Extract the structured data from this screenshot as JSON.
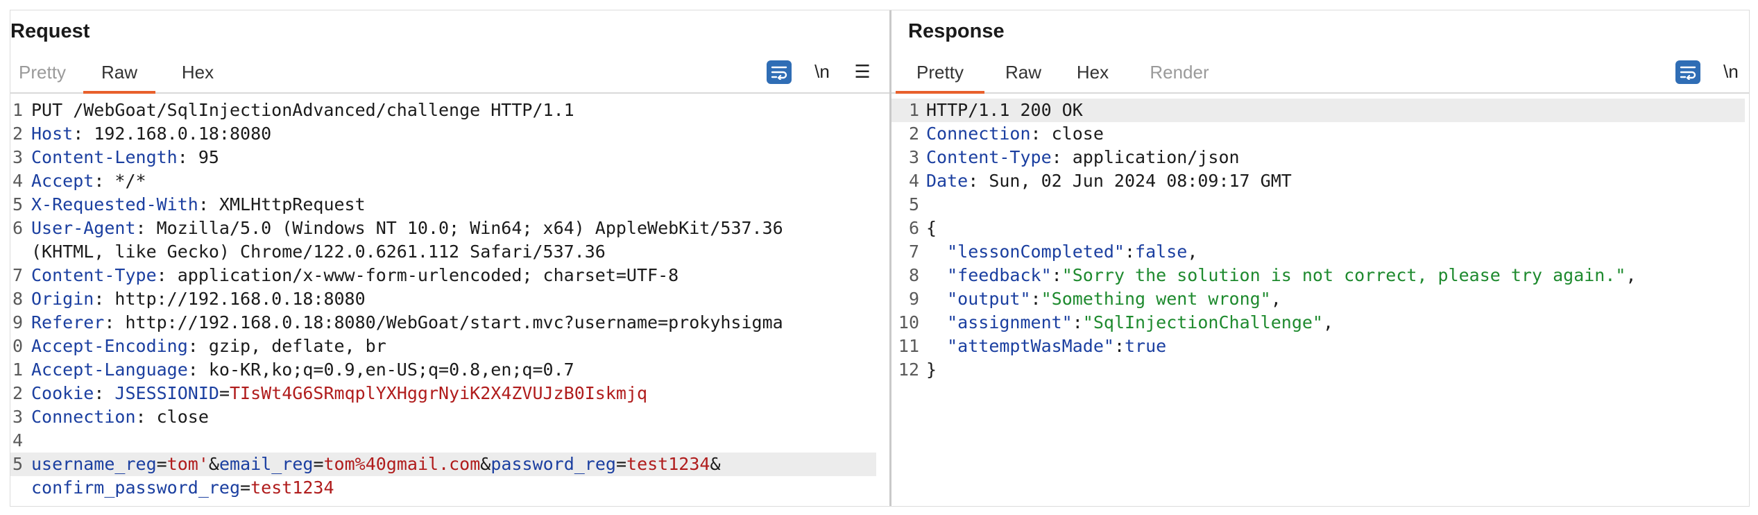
{
  "colors": {
    "accent_tab": "#e8602c",
    "wrap_button": "#2f6db5",
    "key": "#1b3fa0",
    "param_value": "#b01c1c",
    "json_string": "#1e8a2e"
  },
  "request": {
    "title": "Request",
    "tabs": [
      "Pretty",
      "Raw",
      "Hex"
    ],
    "active_tab": "Raw",
    "tools": {
      "newline": "\\n",
      "menu": "☰"
    },
    "lines": [
      {
        "n": "1",
        "text": "PUT /WebGoat/SqlInjectionAdvanced/challenge HTTP/1.1"
      },
      {
        "n": "2",
        "key": "Host",
        "value": " 192.168.0.18:8080"
      },
      {
        "n": "3",
        "key": "Content-Length",
        "value": " 95"
      },
      {
        "n": "4",
        "key": "Accept",
        "value": " */*"
      },
      {
        "n": "5",
        "key": "X-Requested-With",
        "value": " XMLHttpRequest"
      },
      {
        "n": "6",
        "key": "User-Agent",
        "value": " Mozilla/5.0 (Windows NT 10.0; Win64; x64) AppleWebKit/537.36"
      },
      {
        "n": "",
        "text": "(KHTML, like Gecko) Chrome/122.0.6261.112 Safari/537.36"
      },
      {
        "n": "7",
        "key": "Content-Type",
        "value": " application/x-www-form-urlencoded; charset=UTF-8"
      },
      {
        "n": "8",
        "key": "Origin",
        "value": " http://192.168.0.18:8080"
      },
      {
        "n": "9",
        "key": "Referer",
        "value": " http://192.168.0.18:8080/WebGoat/start.mvc?username=prokyhsigma"
      },
      {
        "n": "0",
        "key": "Accept-Encoding",
        "value": " gzip, deflate, br"
      },
      {
        "n": "1",
        "key": "Accept-Language",
        "value": " ko-KR,ko;q=0.9,en-US;q=0.8,en;q=0.7"
      },
      {
        "n": "2",
        "key": "Cookie",
        "value": " ",
        "cookie_name": "JSESSIONID",
        "cookie_value": "TIsWt4G6SRmqplYXHggrNyiK2X4ZVUJzB0Iskmjq"
      },
      {
        "n": "3",
        "key": "Connection",
        "value": " close"
      },
      {
        "n": "4",
        "text": ""
      },
      {
        "n": "5",
        "params": [
          {
            "name": "username_reg",
            "value": "tom'"
          },
          {
            "name": "email_reg",
            "value": "tom%40gmail.com"
          },
          {
            "name": "password_reg",
            "value": "test1234"
          }
        ],
        "trailing": "&",
        "highlight": true
      },
      {
        "n": "",
        "params": [
          {
            "name": "confirm_password_reg",
            "value": "test1234"
          }
        ]
      }
    ]
  },
  "response": {
    "title": "Response",
    "tabs": [
      "Pretty",
      "Raw",
      "Hex",
      "Render"
    ],
    "active_tab": "Pretty",
    "tools": {
      "newline": "\\n"
    },
    "lines": [
      {
        "n": "1",
        "text": "HTTP/1.1 200 OK",
        "highlight": true
      },
      {
        "n": "2",
        "key": "Connection",
        "value": " close"
      },
      {
        "n": "3",
        "key": "Content-Type",
        "value": " application/json"
      },
      {
        "n": "4",
        "key": "Date",
        "value": " Sun, 02 Jun 2024 08:09:17 GMT"
      },
      {
        "n": "5",
        "text": ""
      },
      {
        "n": "6",
        "text": "{"
      },
      {
        "n": "7",
        "jkey": "\"lessonCompleted\"",
        "jval": "false",
        "jtype": "lit",
        "comma": true
      },
      {
        "n": "8",
        "jkey": "\"feedback\"",
        "jval": "\"Sorry the solution is not correct, please try again.\"",
        "jtype": "str",
        "comma": true
      },
      {
        "n": "9",
        "jkey": "\"output\"",
        "jval": "\"Something went wrong\"",
        "jtype": "str",
        "comma": true
      },
      {
        "n": "10",
        "jkey": "\"assignment\"",
        "jval": "\"SqlInjectionChallenge\"",
        "jtype": "str",
        "comma": true
      },
      {
        "n": "11",
        "jkey": "\"attemptWasMade\"",
        "jval": "true",
        "jtype": "lit",
        "comma": false
      },
      {
        "n": "12",
        "text": "}"
      }
    ]
  }
}
